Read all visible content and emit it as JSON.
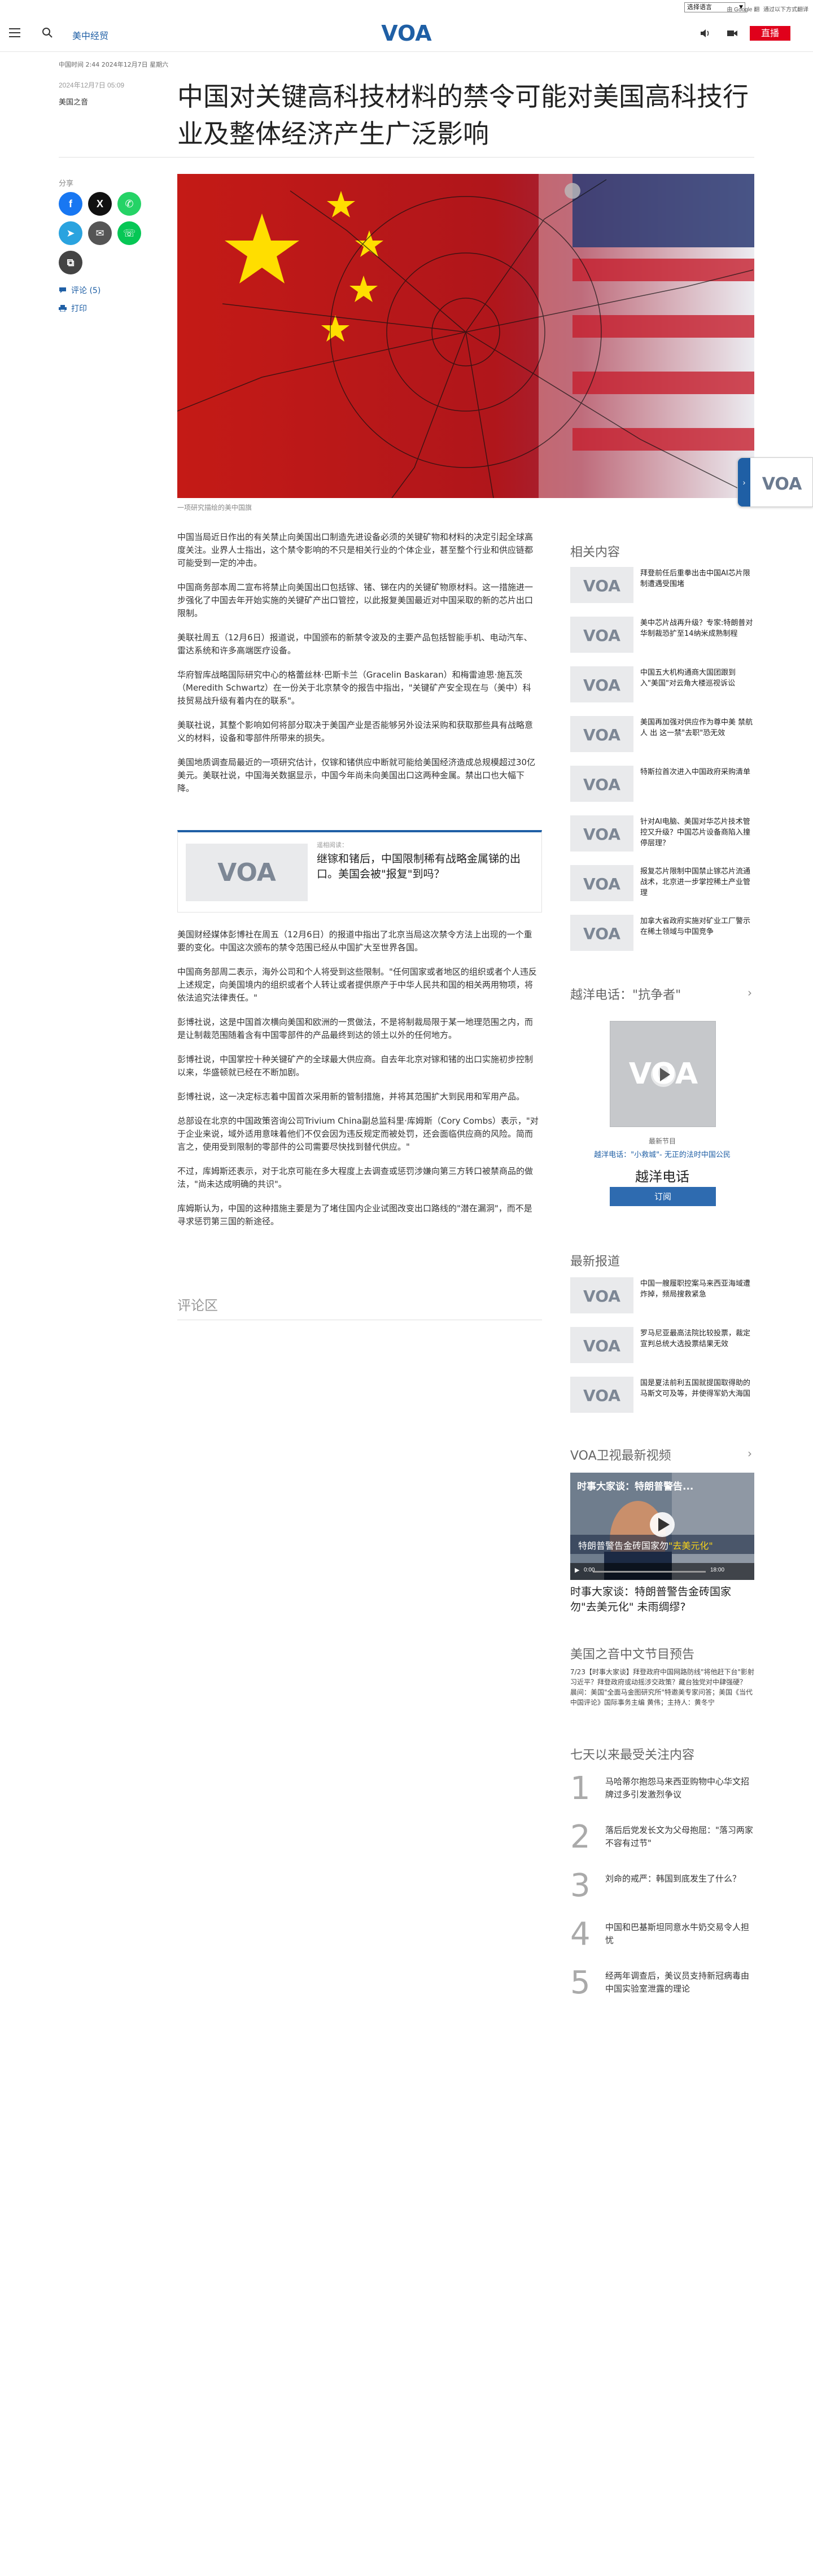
{
  "util": {
    "lang_select": "选择语言",
    "links": [
      "由 Google 翻",
      "通过以下方式翻译"
    ]
  },
  "header": {
    "section": "美中经贸",
    "live": "直播"
  },
  "article": {
    "meta_top": "中国时间 2:44 2024年12月7日 星期六",
    "date": "2024年12月7日 05:09",
    "author": "美国之音",
    "title": "中国对关键高科技材料的禁令可能对美国高科技行业及整体经济产生广泛影响",
    "caption": "一项研究描绘的美中国旗",
    "paragraphs_a": [
      "中国当局近日作出的有关禁止向美国出口制造先进设备必须的关键矿物和材料的决定引起全球高度关注。业界人士指出，这个禁令影响的不只是相关行业的个体企业，甚至整个行业和供应链都可能受到一定的冲击。",
      "中国商务部本周二宣布将禁止向美国出口包括镓、锗、锑在内的关键矿物原材料。这一措施进一步强化了中国去年开始实施的关键矿产出口管控，以此报复美国最近对中国采取的新的芯片出口限制。",
      "美联社周五（12月6日）报道说，中国颁布的新禁令波及的主要产品包括智能手机、电动汽车、雷达系统和许多高端医疗设备。",
      "华府智库战略国际研究中心的格蕾丝林·巴斯卡兰（Gracelin Baskaran）和梅雷迪思·施瓦茨（Meredith Schwartz）在一份关于北京禁令的报告中指出，\"关键矿产安全现在与（美中）科技贸易战升级有着内在的联系\"。",
      "美联社说，其整个影响如何将部分取决于美国产业是否能够另外设法采购和获取那些具有战略意义的材料，设备和零部件所带来的损失。",
      "美国地质调查局最近的一项研究估计，仅镓和锗供应中断就可能给美国经济造成总规模超过30亿美元。美联社说，中国海关数据显示，中国今年尚未向美国出口这两种金属。禁出口也大幅下降。"
    ],
    "related": {
      "label": "遥相阅读：",
      "title": "继镓和锗后，中国限制稀有战略金属锑的出口。美国会被\"报复\"到吗？"
    },
    "paragraphs_b": [
      "美国财经媒体彭博社在周五（12月6日）的报道中指出了北京当局这次禁令方法上出现的一个重要的变化。中国这次颁布的禁令范围已经从中国扩大至世界各国。",
      "中国商务部周二表示，海外公司和个人将受到这些限制。\"任何国家或者地区的组织或者个人违反上述规定，向美国境内的组织或者个人转让或者提供原产于中华人民共和国的相关两用物项，将依法追究法律责任。\"",
      "彭博社说，这是中国首次横向美国和欧洲的一贯做法，不是将制裁局限于某一地理范围之内，而是让制裁范围随着含有中国零部件的产品最终到达的领土以外的任何地方。",
      "彭博社说，中国掌控十种关键矿产的全球最大供应商。自去年北京对镓和锗的出口实施初步控制以来，华盛顿就已经在不断加剧。",
      "彭博社说，这一决定标志着中国首次采用新的管制措施，并将其范围扩大到民用和军用产品。",
      "总部设在北京的中国政策咨询公司Trivium China副总监科里·库姆斯（Cory Combs）表示，\"对于企业来说，域外适用意味着他们不仅会因为违反规定而被处罚，还会面临供应商的风险。简而言之，使用受到限制的零部件的公司需要尽快找到替代供应。\"",
      "不过，库姆斯还表示，对于北京可能在多大程度上去调查或惩罚涉嫌向第三方转口被禁商品的做法，\"尚未达成明确的共识\"。",
      "库姆斯认为，中国的这种措施主要是为了堵住国内企业试图改变出口路线的\"潜在漏洞\"，而不是寻求惩罚第三国的新途径。"
    ],
    "comments": "评论区"
  },
  "share": {
    "label": "分享",
    "comment": "评论 (5)",
    "print": "打印"
  },
  "sidebar": {
    "related_heading": "相关内容",
    "related": [
      "拜登前任后重拳出击中国AI芯片限制遭遇受围堵",
      "美中芯片战再升级？专家:特朗普对华制裁恐扩至14纳米成熟制程",
      "中国五大机构通商大国团跟到入\"美国\"对云角大楼巡视诉讼",
      "美国再加强对供应作为尊中美 禁航人 出 这一禁\"去职\"恐无效",
      "特斯拉首次进入中国政府采购清单",
      "针对AI电脑、美国对华芯片技术管控又升级？中国芯片设备商陷入撞停层理？",
      "报复芯片限制中国禁止镓芯片流通战术，北京进一步掌控稀土产业管理",
      "加拿大省政府实施对矿业工厂警示在稀土领域与中国竞争"
    ],
    "radio_heading": "越洋电话：\"抗争者\"",
    "radio_prog": "最新节目",
    "radio_sub": "越洋电话：\"小救城\"- 无正的法时中国公民",
    "radio_name": "越洋电话",
    "radio_btn": "订阅",
    "latest_heading": "最新报道",
    "latest": [
      "中国一艘履职控案马来西亚海域遭炸掉，频局搜救紧急",
      "罗马尼亚最高法院比较投票，裁定宣判总统大选投票结果无效",
      "国是夏法前利五国就提国取得助的马斯文可及等，并使得军奶大海国"
    ],
    "video_heading": "VOA卫视最新视频",
    "video_overlay": "时事大家谈：特朗普警告...",
    "video_caption_a": "特朗普警告金砖国家勿",
    "video_caption_b": "\"去美元化\"",
    "video_time": "0:00",
    "video_dur": "18:00",
    "video_title": "时事大家谈：特朗普警告金砖国家勿\"去美元化\" 未雨绸缪?",
    "sched_heading": "美国之音中文节目预告",
    "sched_text": "7/23【时事大家谈】拜登政府中国网路防线\"将他赶下台\"影射习近平？拜登政府或动摇涉交政策？藏台独党对中肆强硬？ 晨间：美国\"全面马金图研究所\"特邀美专家问答；美国《当代中国评论》国际事务主编 黄伟；主持人：黄冬宁",
    "popular_heading": "七天以来最受关注内容",
    "popular": [
      {
        "num": "1",
        "text": "马哈蒂尔抱怨马来西亚购物中心华文招牌过多引发激烈争议"
      },
      {
        "num": "2",
        "text": "落后后党发长文为父母抱屈：\"落习两家不容有过节\""
      },
      {
        "num": "3",
        "text": "刘命的戒严：韩国到底发生了什么？"
      },
      {
        "num": "4",
        "text": "中国和巴基斯坦同意水牛奶交易令人担忧"
      },
      {
        "num": "5",
        "text": "经两年调查后，美议员支持新冠病毒由中国实验室泄露的理论"
      }
    ]
  },
  "colors": {
    "brand": "#1f5fa5",
    "live": "#e0001b",
    "facebook": "#1877f2",
    "x": "#111111",
    "whatsapp": "#25d366",
    "telegram": "#2aa3df",
    "email": "#555555",
    "line": "#06c755",
    "copy": "#444444"
  },
  "icons": [
    "hamburger-icon",
    "search-icon",
    "volume-icon",
    "video-icon",
    "facebook-icon",
    "x-icon",
    "whatsapp-icon",
    "telegram-icon",
    "email-icon",
    "line-icon",
    "copy-icon",
    "comment-icon",
    "print-icon",
    "play-icon",
    "chevron-right-icon"
  ]
}
